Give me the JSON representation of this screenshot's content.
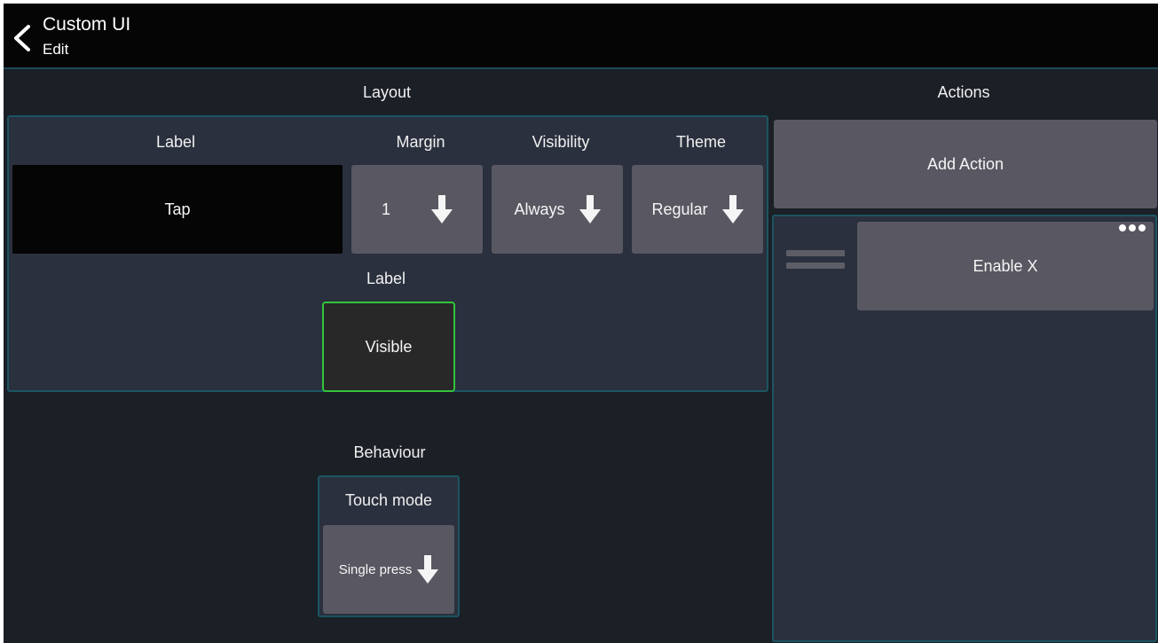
{
  "header": {
    "title": "Custom UI",
    "subtitle": "Edit",
    "back_icon": "chevron-left-icon"
  },
  "layout": {
    "section_title": "Layout",
    "label_col": "Label",
    "label_value": "Tap",
    "margin_col": "Margin",
    "margin_value": "1",
    "visibility_col": "Visibility",
    "visibility_value": "Always",
    "theme_col": "Theme",
    "theme_value": "Regular",
    "label_visibility_col": "Label",
    "label_visibility_value": "Visible",
    "active_color": "#33c43a"
  },
  "behaviour": {
    "section_title": "Behaviour",
    "touch_mode_label": "Touch mode",
    "touch_mode_value": "Single press"
  },
  "actions": {
    "section_title": "Actions",
    "add_button": "Add Action",
    "items": [
      {
        "label": "Enable X"
      }
    ],
    "more_icon": "more-horizontal-icon",
    "drag_icon": "drag-handle-icon"
  }
}
